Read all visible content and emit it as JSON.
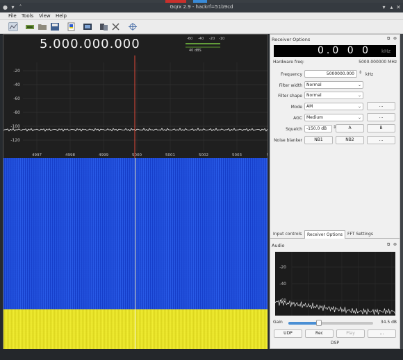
{
  "window": {
    "title": "Gqrx 2.9 - hackrf=51b9cd"
  },
  "menu": {
    "items": [
      "File",
      "Tools",
      "View",
      "Help"
    ]
  },
  "spectrum": {
    "frequency_display": "5.000.000.000",
    "db_ticks": [
      "-20",
      "-40",
      "-60",
      "-80",
      "-100",
      "-120"
    ],
    "freq_ticks": [
      "4997",
      "4998",
      "4999",
      "5000",
      "5001",
      "5002",
      "5003",
      "500"
    ],
    "mini_scale": [
      "-60",
      "-40",
      "-20",
      "-10"
    ],
    "mini_label": "40 dBS",
    "noise_floor_db": -105,
    "carrier_peak_db": -62
  },
  "receiver": {
    "dock_title": "Receiver Options",
    "lcd_value": "0.0 0 0",
    "lcd_unit": "kHz",
    "hw_freq_label": "Hardware freq:",
    "hw_freq_value": "5000.000000 MHz",
    "frequency_label": "Frequency",
    "frequency_value": "5000000.000",
    "frequency_unit": "kHz",
    "filter_width_label": "Filter width",
    "filter_width_value": "Normal",
    "filter_shape_label": "Filter shape",
    "filter_shape_value": "Normal",
    "mode_label": "Mode",
    "mode_value": "AM",
    "mode_extra": "...",
    "agc_label": "AGC",
    "agc_value": "Medium",
    "agc_extra": "...",
    "squelch_label": "Squelch",
    "squelch_value": "-150.0 dB",
    "squelch_a": "A",
    "squelch_b": "B",
    "noise_blanker_label": "Noise blanker",
    "nb1": "NB1",
    "nb2": "NB2",
    "nb_extra": "..."
  },
  "tabs": {
    "items": [
      "Input controls",
      "Receiver Options",
      "FFT Settings"
    ],
    "selected": 1
  },
  "audio": {
    "dock_title": "Audio",
    "db_ticks": [
      "-20",
      "-40",
      "-60"
    ],
    "gain_label": "Gain",
    "gain_value": "34.5 dB",
    "gain_level": 0.36,
    "udp": "UDP",
    "rec": "Rec",
    "play": "Play",
    "extra": "...",
    "dsp": "DSP"
  },
  "colors": {
    "waterfall_low": "#2552d9",
    "waterfall_high": "#e6e226",
    "marker": "#e04a3a",
    "accent": "#4a8fd4"
  }
}
